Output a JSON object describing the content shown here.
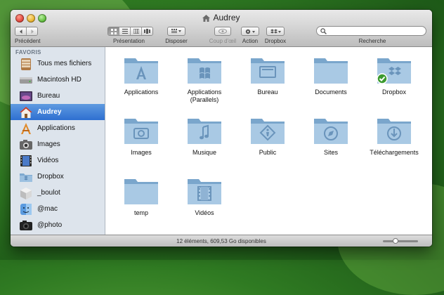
{
  "window": {
    "title": "Audrey"
  },
  "toolbar": {
    "back_label": "Précédent",
    "view_label": "Présentation",
    "arrange_label": "Disposer",
    "quicklook_label": "Coup d'œil",
    "action_label": "Action",
    "dropbox_label": "Dropbox",
    "search_label": "Recherche",
    "search_placeholder": ""
  },
  "sidebar": {
    "header": "FAVORIS",
    "items": [
      {
        "label": "Tous mes fichiers",
        "icon": "all-files-icon"
      },
      {
        "label": "Macintosh HD",
        "icon": "hard-drive-icon"
      },
      {
        "label": "Bureau",
        "icon": "desktop-icon"
      },
      {
        "label": "Audrey",
        "icon": "home-icon",
        "selected": true
      },
      {
        "label": "Applications",
        "icon": "applications-icon"
      },
      {
        "label": "Images",
        "icon": "camera-icon"
      },
      {
        "label": "Vidéos",
        "icon": "film-icon"
      },
      {
        "label": "Dropbox",
        "icon": "dropbox-folder-icon"
      },
      {
        "label": "_boulot",
        "icon": "box-icon"
      },
      {
        "label": "@mac",
        "icon": "finder-icon"
      },
      {
        "label": "@photo",
        "icon": "camera-dark-icon"
      }
    ]
  },
  "folders": [
    {
      "label": "Applications",
      "icon": "applications-folder-icon"
    },
    {
      "label": "Applications\n(Parallels)",
      "icon": "parallels-folder-icon"
    },
    {
      "label": "Bureau",
      "icon": "desktop-folder-icon"
    },
    {
      "label": "Documents",
      "icon": "documents-folder-icon"
    },
    {
      "label": "Dropbox",
      "icon": "dropbox-folder-icon"
    },
    {
      "label": "Images",
      "icon": "pictures-folder-icon"
    },
    {
      "label": "Musique",
      "icon": "music-folder-icon"
    },
    {
      "label": "Public",
      "icon": "public-folder-icon"
    },
    {
      "label": "Sites",
      "icon": "sites-folder-icon"
    },
    {
      "label": "Téléchargements",
      "icon": "downloads-folder-icon"
    },
    {
      "label": "temp",
      "icon": "folder-icon"
    },
    {
      "label": "Vidéos",
      "icon": "movies-folder-icon"
    }
  ],
  "status": {
    "text": "12 éléments, 609,53 Go disponibles"
  },
  "colors": {
    "folder": "#8fb6d6",
    "selection": "#3b7dd8",
    "sync_check": "#3c9a2f"
  }
}
